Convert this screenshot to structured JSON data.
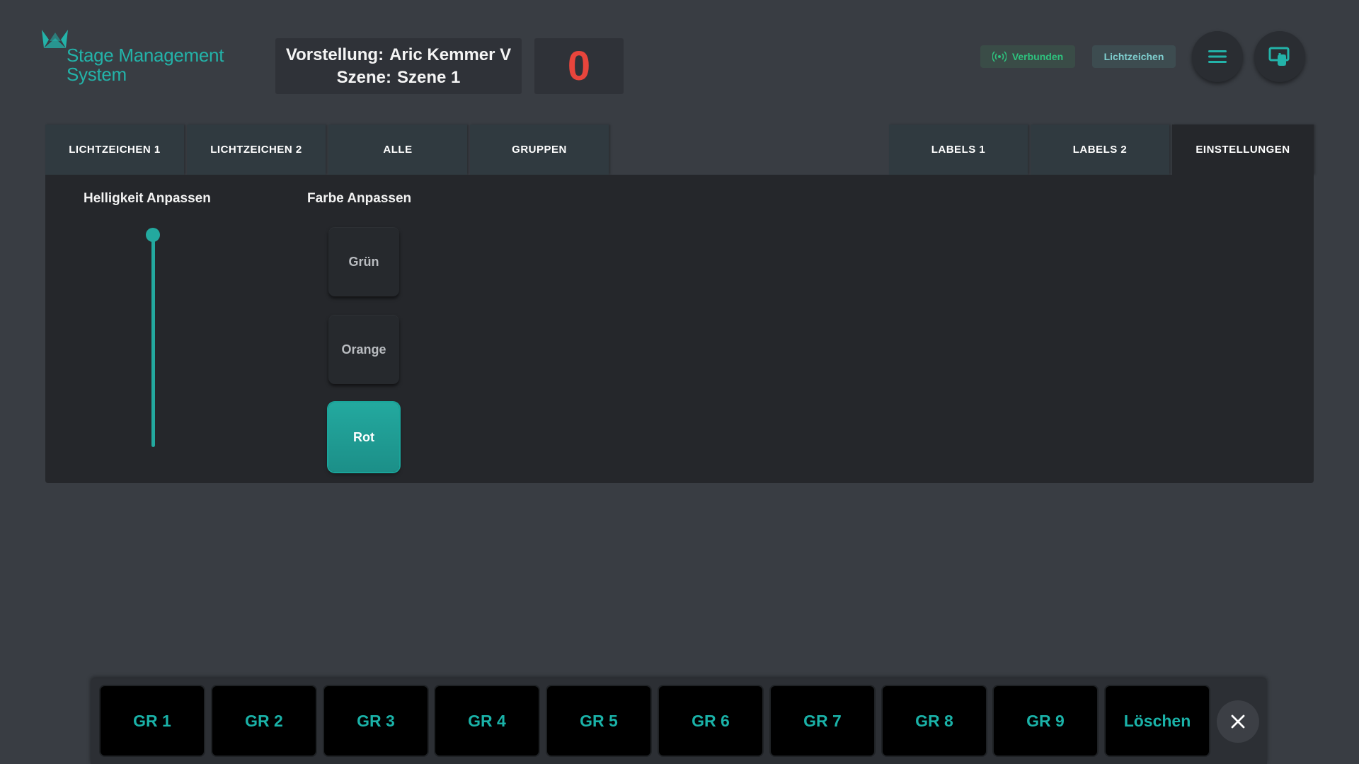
{
  "brand": {
    "line1": "Stage Management",
    "line2": "System",
    "color": "#23b3a9"
  },
  "show": {
    "performance_label": "Vorstellung:",
    "performance_value": "Aric Kemmer V",
    "scene_label": "Szene:",
    "scene_value": "Szene 1"
  },
  "counter": {
    "value": "0",
    "color": "#e8453c"
  },
  "status": {
    "connected_label": "Verbunden",
    "mode_label": "Lichtzeichen"
  },
  "header_buttons": {
    "menu_icon": "hamburger-menu-icon",
    "cast_icon": "touch-screen-icon"
  },
  "tabs": [
    {
      "label": "LICHTZEICHEN 1"
    },
    {
      "label": "LICHTZEICHEN 2"
    },
    {
      "label": "ALLE"
    },
    {
      "label": "GRUPPEN"
    },
    {
      "label": "LABELS 1"
    },
    {
      "label": "LABELS 2"
    },
    {
      "label": "EINSTELLUNGEN",
      "active": true
    }
  ],
  "settings": {
    "brightness_title": "Helligkeit Anpassen",
    "brightness_level": 1.0,
    "color_title": "Farbe Anpassen",
    "colors": [
      {
        "label": "Grün"
      },
      {
        "label": "Orange"
      },
      {
        "label": "Rot",
        "selected": true
      }
    ],
    "accent": "#23a99f"
  },
  "groups": {
    "buttons": [
      "GR 1",
      "GR 2",
      "GR 3",
      "GR 4",
      "GR 5",
      "GR 6",
      "GR 7",
      "GR 8",
      "GR 9",
      "Löschen"
    ],
    "close_icon": "close-icon"
  }
}
